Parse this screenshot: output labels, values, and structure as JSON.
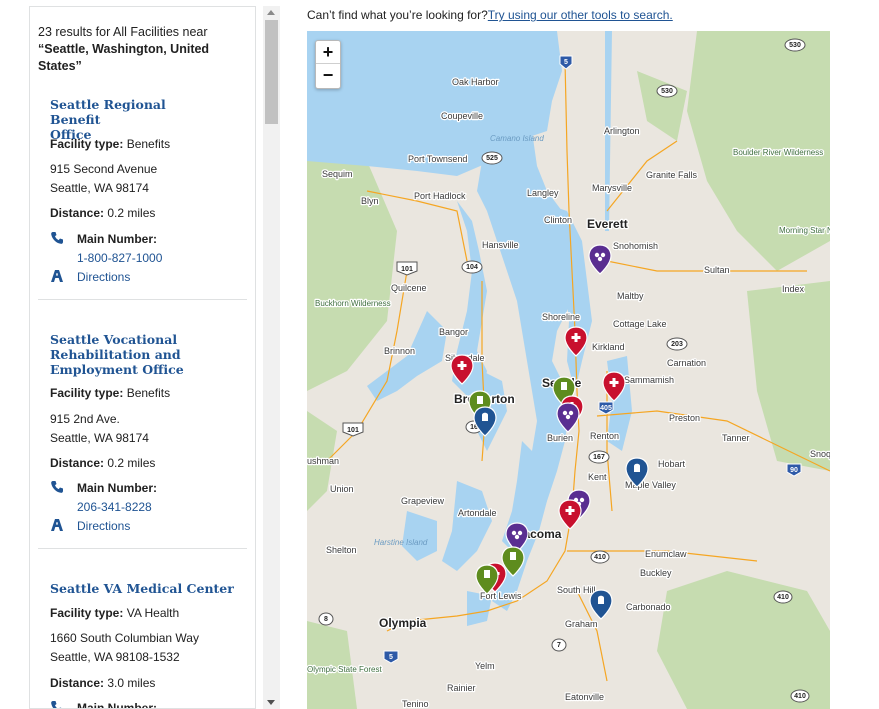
{
  "results": {
    "summary_prefix": "23 results for All Facilities near",
    "location": "“Seattle, Washington, United States”",
    "facility_type_label": "Facility type:",
    "distance_label": "Distance:",
    "main_number_label": "Main Number:",
    "directions_label": "Directions",
    "items": [
      {
        "name_line1": "Seattle Regional Benefit",
        "name_line2": "Office",
        "name_line3": "",
        "facility_type": "Benefits",
        "address1": "915 Second Avenue",
        "address2": "Seattle, WA 98174",
        "distance": "0.2 miles",
        "phone": "1-800-827-1000"
      },
      {
        "name_line1": "Seattle Vocational",
        "name_line2": "Rehabilitation and",
        "name_line3": "Employment Office",
        "facility_type": "Benefits",
        "address1": "915 2nd Ave.",
        "address2": "Seattle, WA 98174",
        "distance": "0.2 miles",
        "phone": "206-341-8228"
      },
      {
        "name_line1": "Seattle VA Medical Center",
        "name_line2": "",
        "name_line3": "",
        "facility_type": "VA Health",
        "address1": "1660 South Columbian Way",
        "address2": "Seattle, WA 98108-1532",
        "distance": "3.0 miles",
        "phone": ""
      }
    ]
  },
  "top_message": {
    "text": "Can’t find what you’re looking for?",
    "link": "Try using our other tools to search."
  },
  "map": {
    "zoom_in": "+",
    "zoom_out": "−",
    "colors": {
      "water": "#a8d3f1",
      "land": "#eae6df",
      "park": "#c6dcb0",
      "health": "#c8102e",
      "benefits": "#5e8c1e",
      "vet_center": "#5a2e91",
      "cemetery": "#205493"
    },
    "places": [
      "Oak Harbor",
      "Coupeville",
      "Camano Island",
      "Arlington",
      "Port Townsend",
      "Sequim",
      "Blyn",
      "Port Hadlock",
      "Langley",
      "Marysville",
      "Granite Falls",
      "Boulder River Wilderness",
      "Clinton",
      "Everett",
      "Snohomish",
      "Hansville",
      "Morning Star NRCA",
      "Sultan",
      "Quilcene",
      "Buckhorn Wilderness",
      "Maltby",
      "Index",
      "Shoreline",
      "Cottage Lake",
      "Bangor",
      "Brinnon",
      "Silverdale",
      "Kirkland",
      "Carnation",
      "Seattle",
      "Sammamish",
      "Bremerton",
      "Preston",
      "Burien",
      "Renton",
      "Tanner",
      "Hobart",
      "Snoqualmie",
      "ushman",
      "Kent",
      "Maple Valley",
      "Union",
      "Grapeview",
      "Artondale",
      "Tacoma",
      "Shelton",
      "Harstine Island",
      "Enumclaw",
      "Buckley",
      "South Hill",
      "Fort Lewis",
      "Carbonado",
      "Olympia",
      "Graham",
      "Yelm",
      "Rainier",
      "Eatonville",
      "Tenino",
      "Olympic State Forest"
    ],
    "highways": [
      "5",
      "530",
      "530",
      "525",
      "101",
      "104",
      "203",
      "405",
      "167",
      "90",
      "16",
      "101",
      "410",
      "3",
      "8",
      "5",
      "7",
      "410",
      "410"
    ]
  }
}
